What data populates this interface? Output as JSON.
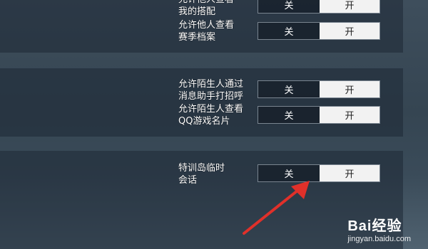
{
  "settings": [
    {
      "label": "允许他人查看\n我的搭配",
      "off": "关",
      "on": "开"
    },
    {
      "label": "允许他人查看\n赛季档案",
      "off": "关",
      "on": "开"
    },
    {
      "label": "允许陌生人通过\n消息助手打招呼",
      "off": "关",
      "on": "开"
    },
    {
      "label": "允许陌生人查看\nQQ游戏名片",
      "off": "关",
      "on": "开"
    },
    {
      "label": "特训岛临时\n会话",
      "off": "关",
      "on": "开"
    }
  ],
  "watermark": {
    "brand": "Bai经验",
    "url": "jingyan.baidu.com"
  },
  "colors": {
    "panel": "#1e2834",
    "toggle_on": "#f2f2f2",
    "arrow": "#e0302a"
  }
}
